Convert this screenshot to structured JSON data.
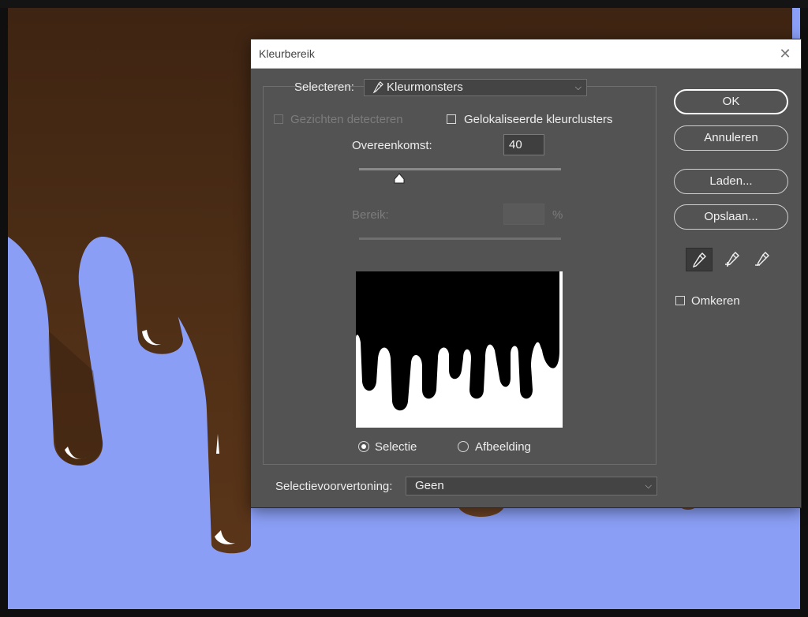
{
  "dialog": {
    "title": "Kleurbereik",
    "close_glyph": "✕",
    "select_label": "Selecteren:",
    "select_value": "Kleurmonsters",
    "select_icon": "eyedropper-icon",
    "faces_checkbox_label": "Gezichten detecteren",
    "localized_checkbox_label": "Gelokaliseerde kleurclusters",
    "fuzziness_label": "Overeenkomst:",
    "fuzziness_value": "40",
    "fuzziness_level": 0.2,
    "range_label": "Bereik:",
    "range_value": "",
    "range_unit": "%",
    "radio_selection_label": "Selectie",
    "radio_image_label": "Afbeelding",
    "radio_selected": "Selectie",
    "preview_label": "Selectievoorvertoning:",
    "preview_value": "Geen",
    "chevron_glyph": "⌵"
  },
  "buttons": {
    "ok": "OK",
    "cancel": "Annuleren",
    "load": "Laden...",
    "save": "Opslaan..."
  },
  "tools": [
    "eyedropper-icon",
    "eyedropper-plus-icon",
    "eyedropper-minus-icon"
  ],
  "invert_label": "Omkeren",
  "colors": {
    "background": "#8a9ef5",
    "chocolate": "#4a2b14",
    "dialog": "#535353"
  }
}
